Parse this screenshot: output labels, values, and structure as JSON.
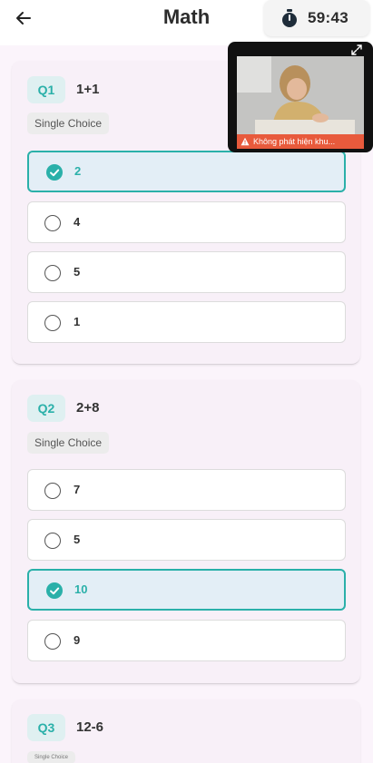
{
  "header": {
    "title": "Math",
    "timer": "59:43"
  },
  "questions": [
    {
      "number": "Q1",
      "text": "1+1",
      "type": "Single Choice",
      "options": [
        {
          "label": "2",
          "selected": true
        },
        {
          "label": "4",
          "selected": false
        },
        {
          "label": "5",
          "selected": false
        },
        {
          "label": "1",
          "selected": false
        }
      ]
    },
    {
      "number": "Q2",
      "text": "2+8",
      "type": "Single Choice",
      "options": [
        {
          "label": "7",
          "selected": false
        },
        {
          "label": "5",
          "selected": false
        },
        {
          "label": "10",
          "selected": true
        },
        {
          "label": "9",
          "selected": false
        }
      ]
    },
    {
      "number": "Q3",
      "text": "12-6",
      "type": "Single Choice",
      "options": []
    }
  ],
  "camera": {
    "warning": "Không phát hiện khu..."
  },
  "colors": {
    "accent": "#2ab0a9",
    "warning": "#e85a3c"
  }
}
